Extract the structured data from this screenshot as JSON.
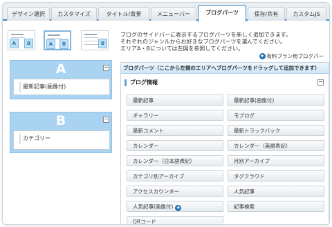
{
  "tabs": [
    {
      "label": "デザイン選択"
    },
    {
      "label": "カスタマイズ"
    },
    {
      "label": "タイトル/背景"
    },
    {
      "label": "メニューバー"
    },
    {
      "label": "ブログパーツ"
    },
    {
      "label": "保存/共有"
    },
    {
      "label": "カスタムJS"
    }
  ],
  "active_tab": "ブログパーツ",
  "layout_thumbs": [
    {
      "label_a": "A",
      "label_b": "B"
    },
    {
      "label_a": "A",
      "label_b": "B"
    },
    {
      "label_a": "",
      "label_b": "B"
    }
  ],
  "intro": {
    "line1": "ブログのサイドバーに表示するブログパーツを新しく追加できます。",
    "line2": "それぞれのジャンルからお好きなブログパーツを選んでください。",
    "line3": "エリアA・Bについては左図を参照してください。"
  },
  "legend": {
    "icon": "star-icon",
    "label": "有料プラン用ブログパー"
  },
  "area_a": {
    "letter": "A",
    "items": [
      "最新記事(画像付)"
    ]
  },
  "area_b": {
    "letter": "B",
    "items": [
      "カテゴリー"
    ]
  },
  "parts_panel": {
    "header": "ブログパーツ（ここから左側のエリアへブログパーツをドラッグして追加できます）",
    "section_title": "ブログ情報",
    "parts": [
      {
        "label": "最新記事"
      },
      {
        "label": "最新記事(画像付)"
      },
      {
        "label": "ギャラリー"
      },
      {
        "label": "モブログ"
      },
      {
        "label": "最新コメント"
      },
      {
        "label": "最新トラックバック"
      },
      {
        "label": "カレンダー"
      },
      {
        "label": "カレンダー（英語表記）"
      },
      {
        "label": "カレンダー（日本語表記）"
      },
      {
        "label": "月別アーカイブ"
      },
      {
        "label": "カテゴリ別アーカイブ"
      },
      {
        "label": "タグクラウド"
      },
      {
        "label": "アクセスカウンター"
      },
      {
        "label": "人気記事"
      },
      {
        "label": "人気記事(画像付)",
        "premium": true
      },
      {
        "label": "記事検索"
      },
      {
        "label": "QRコード"
      }
    ]
  },
  "colors": {
    "accent": "#2f86c9",
    "area_bg": "#a9d3f1",
    "premium_icon": "#1d6fb5"
  }
}
